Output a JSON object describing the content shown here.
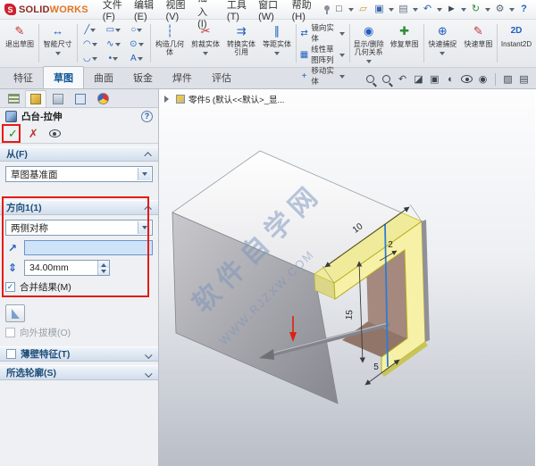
{
  "titlebar": {
    "brand": {
      "s": "S",
      "prefix": "SOLID",
      "suffix": "WORKS"
    },
    "menus": [
      {
        "label": "文件(F)"
      },
      {
        "label": "编辑(E)"
      },
      {
        "label": "视图(V)"
      },
      {
        "label": "插入(I)"
      },
      {
        "label": "工具(T)"
      },
      {
        "label": "窗口(W)"
      },
      {
        "label": "帮助(H)"
      }
    ],
    "quick_icons": [
      {
        "name": "new-document",
        "glyph": "□"
      },
      {
        "name": "open",
        "glyph": "▱"
      },
      {
        "name": "save",
        "glyph": "▣"
      },
      {
        "name": "print",
        "glyph": "▤"
      },
      {
        "name": "undo",
        "glyph": "↶"
      },
      {
        "name": "select",
        "glyph": "►"
      },
      {
        "name": "rebuild",
        "glyph": "↻"
      },
      {
        "name": "options",
        "glyph": "⚙"
      },
      {
        "name": "help",
        "glyph": "?"
      }
    ]
  },
  "command_bar": {
    "groups": [
      {
        "label": "退出草图",
        "glyph": "✎"
      },
      {
        "label": "智能尺寸",
        "glyph": "↔"
      },
      {
        "label": "构造几何体",
        "glyph": "┆"
      },
      {
        "label": "剪裁实体",
        "glyph": "✂"
      },
      {
        "label": "转换实体引用",
        "glyph": "⇉"
      },
      {
        "label": "等距实体",
        "glyph": "∥"
      },
      {
        "label": "镜向实体",
        "glyph": "⇄"
      },
      {
        "label": "线性草图阵列",
        "glyph": "▦"
      },
      {
        "label": "移动实体",
        "glyph": "+"
      },
      {
        "label": "显示/删除几何关系",
        "glyph": "◉"
      },
      {
        "label": "修复草图",
        "glyph": "✚"
      },
      {
        "label": "快速捕捉",
        "glyph": "⊕"
      },
      {
        "label": "快速草图",
        "glyph": "✎"
      },
      {
        "label": "Instant2D",
        "glyph": "2D"
      }
    ],
    "entity_icons": [
      {
        "name": "line",
        "glyph": "╱"
      },
      {
        "name": "rectangle",
        "glyph": "▭"
      },
      {
        "name": "circle",
        "glyph": "○"
      },
      {
        "name": "arc",
        "glyph": "◠"
      },
      {
        "name": "spline",
        "glyph": "∿"
      },
      {
        "name": "circle-center",
        "glyph": "⊙"
      },
      {
        "name": "ellipse-arc",
        "glyph": "◡"
      },
      {
        "name": "point",
        "glyph": "•"
      },
      {
        "name": "text",
        "glyph": "A"
      }
    ]
  },
  "tabs": {
    "items": [
      {
        "label": "特征"
      },
      {
        "label": "草图"
      },
      {
        "label": "曲面"
      },
      {
        "label": "钣金"
      },
      {
        "label": "焊件"
      },
      {
        "label": "评估"
      }
    ]
  },
  "hud": {
    "icons": [
      {
        "name": "zoom-fit"
      },
      {
        "name": "zoom-area"
      },
      {
        "name": "previous-view",
        "glyph": "↶"
      },
      {
        "name": "section-view",
        "glyph": "◪"
      },
      {
        "name": "view-orientation",
        "glyph": "▣"
      },
      {
        "name": "display-style",
        "glyph": "◐"
      },
      {
        "name": "hide-show-items"
      },
      {
        "name": "edit-appearance",
        "glyph": "◉"
      },
      {
        "name": "apply-scene",
        "glyph": "▨"
      },
      {
        "name": "view-settings",
        "glyph": "▤"
      }
    ]
  },
  "property_manager": {
    "title": "凸台-拉伸",
    "help": "?",
    "ok_icon": "✓",
    "cancel_icon": "✗",
    "from_section": {
      "header": "从(F)",
      "value": "草图基准面"
    },
    "direction1": {
      "header": "方向1(1)",
      "value": "两侧对称",
      "reverse_icon": "↗",
      "depth_icon": "⇕",
      "depth": "34.00mm",
      "merge_check": "✓",
      "merge": "合并结果(M)",
      "draft_out": "向外拔模(O)"
    },
    "thin_feature": {
      "header": "薄壁特征(T)"
    },
    "selected_contours": {
      "header": "所选轮廓(S)"
    }
  },
  "viewport": {
    "breadcrumb": "零件5 (默认<<默认>_显...",
    "dimensions": {
      "top_flange": "10",
      "height": "15",
      "thickness": "2",
      "bottom_flange": "5"
    },
    "watermark": {
      "line1": "软件自学网",
      "line2": "WWW.RJZXW.COM"
    }
  },
  "colors": {
    "annotation_red": "#e51b12",
    "highlight_yellow": "#f6f1a6",
    "selection_blue": "#2e7bd6",
    "accent_blue": "#1f5fbf"
  }
}
